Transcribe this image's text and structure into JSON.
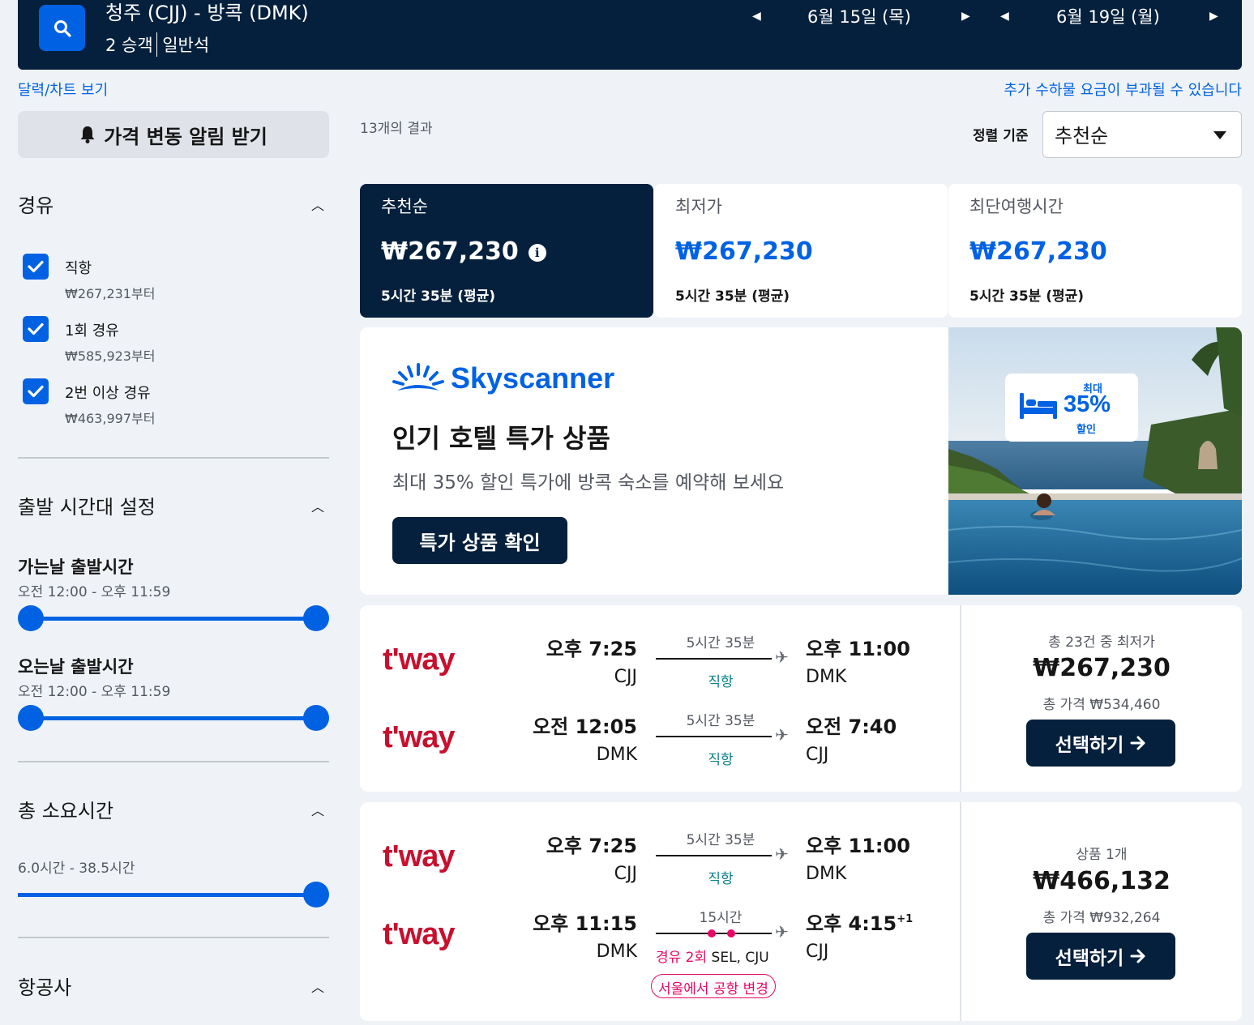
{
  "header": {
    "route": "청주 (CJJ) - 방콕 (DMK)",
    "pax": "2 승객",
    "cabin": "일반석",
    "depart_date": "6월 15일 (목)",
    "return_date": "6월 19일 (월)"
  },
  "links": {
    "calendar": "달력/차트 보기",
    "baggage": "추가 수하물 요금이 부과될 수 있습니다"
  },
  "sidebar": {
    "alert_button": "가격 변동 알림 받기",
    "stops_title": "경유",
    "stops": [
      {
        "label": "직항",
        "price": "₩267,231부터"
      },
      {
        "label": "1회 경유",
        "price": "₩585,923부터"
      },
      {
        "label": "2번 이상 경유",
        "price": "₩463,997부터"
      }
    ],
    "time_title": "출발 시간대 설정",
    "outbound_title": "가는날 출발시간",
    "outbound_range": "오전 12:00 - 오후 11:59",
    "return_title": "오는날 출발시간",
    "return_range": "오전 12:00 - 오후 11:59",
    "duration_title": "총 소요시간",
    "duration_range": "6.0시간 - 38.5시간",
    "airline_title": "항공사"
  },
  "results": {
    "count": "13개의 결과",
    "sort_label": "정렬 기준",
    "sort_value": "추천순"
  },
  "tabs": [
    {
      "label": "추천순",
      "price": "₩267,230",
      "duration": "5시간 35분 (평균)"
    },
    {
      "label": "최저가",
      "price": "₩267,230",
      "duration": "5시간 35분 (평균)"
    },
    {
      "label": "최단여행시간",
      "price": "₩267,230",
      "duration": "5시간 35분 (평균)"
    }
  ],
  "ad": {
    "brand": "Skyscanner",
    "title": "인기 호텔 특가 상품",
    "description": "최대 35% 할인 특가에 방콕 숙소를 예약해 보세요",
    "button": "특가 상품 확인",
    "badge_top": "최대",
    "badge_pct": "35%",
    "badge_bottom": "할인"
  },
  "flights": [
    {
      "price_note": "총 23건 중 최저가",
      "price": "₩267,230",
      "total": "총 가격 ₩534,460",
      "select": "선택하기",
      "legs": [
        {
          "airline": "t'way",
          "dep_time": "오후 7:25",
          "dep_code": "CJJ",
          "duration": "5시간 35분",
          "stops": "직항",
          "arr_time": "오후 11:00",
          "arr_code": "DMK"
        },
        {
          "airline": "t'way",
          "dep_time": "오전 12:05",
          "dep_code": "DMK",
          "duration": "5시간 35분",
          "stops": "직항",
          "arr_time": "오전 7:40",
          "arr_code": "CJJ"
        }
      ]
    },
    {
      "price_note": "상품 1개",
      "price": "₩466,132",
      "total": "총 가격 ₩932,264",
      "select": "선택하기",
      "legs": [
        {
          "airline": "t'way",
          "dep_time": "오후 7:25",
          "dep_code": "CJJ",
          "duration": "5시간 35분",
          "stops": "직항",
          "arr_time": "오후 11:00",
          "arr_code": "DMK"
        },
        {
          "airline": "t'way",
          "dep_time": "오후 11:15",
          "dep_code": "DMK",
          "duration": "15시간",
          "stops_count": "경유 2회",
          "stops_airports": "SEL, CJU",
          "arr_time": "오후 4:15",
          "arr_day": "+1",
          "arr_code": "CJJ",
          "airport_change": "서울에서 공항 변경"
        }
      ]
    }
  ],
  "colors": {
    "navy": "#05203c",
    "blue": "#0062e3",
    "pink": "#e70866",
    "teal": "#0c838a",
    "tway_red": "#c8102e"
  }
}
